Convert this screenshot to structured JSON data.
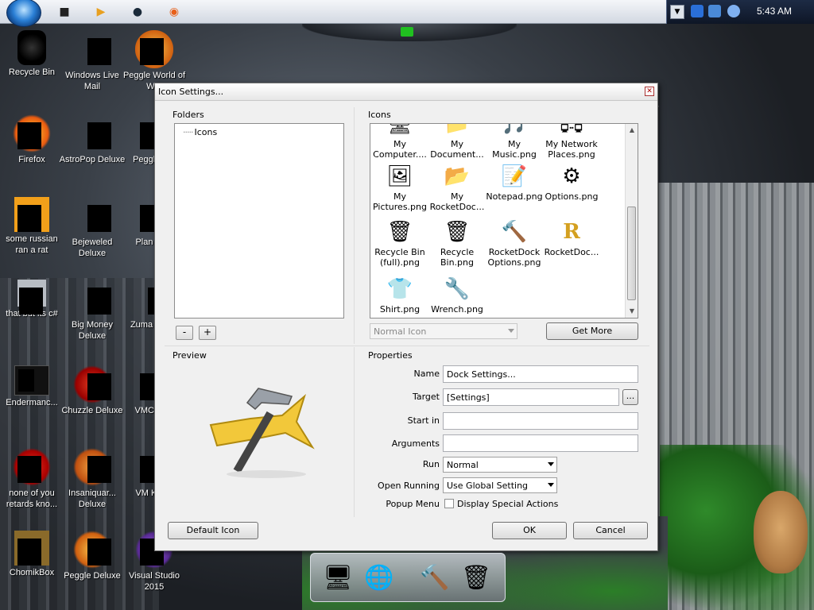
{
  "taskbar": {
    "start_icon": "windows-orb-icon",
    "pinned": [
      {
        "name": "black-cube-icon",
        "glyph": "■",
        "color": "#222222"
      },
      {
        "name": "media-player-icon",
        "glyph": "▶",
        "color": "#e8a020"
      },
      {
        "name": "black-circle-icon",
        "glyph": "●",
        "color": "#1a2a3a"
      },
      {
        "name": "firefox-icon",
        "glyph": "◉",
        "color": "#e8601a"
      }
    ],
    "clock": "5:43 AM"
  },
  "desktop_icons": [
    {
      "label": "Recycle Bin"
    },
    {
      "label": "Windows Live Mail"
    },
    {
      "label": "Peggle World of War"
    },
    {
      "label": "Firefox"
    },
    {
      "label": "AstroPop Deluxe"
    },
    {
      "label": "Peggle Del"
    },
    {
      "label": "some russian ran a rat"
    },
    {
      "label": "Bejeweled Deluxe"
    },
    {
      "label": "Plan Zom"
    },
    {
      "label": "that but its c#"
    },
    {
      "label": "Big Money Deluxe"
    },
    {
      "label": "Zuma"
    },
    {
      "label": "Endermanc..."
    },
    {
      "label": "Chuzzle Deluxe"
    },
    {
      "label": "VMC Kevi"
    },
    {
      "label": "none of you retards kno..."
    },
    {
      "label": "Insaniquar... Deluxe"
    },
    {
      "label": "VM Kevin"
    },
    {
      "label": "ChomikBox"
    },
    {
      "label": "Peggle Deluxe"
    },
    {
      "label": "Visual Studio 2015"
    }
  ],
  "dialog": {
    "title": "Icon Settings...",
    "folders": {
      "label": "Folders",
      "tree_item": "Icons",
      "remove_label": "-",
      "add_label": "+"
    },
    "icons": {
      "label": "Icons",
      "items": [
        {
          "label": "My Computer....",
          "icon": "computer-icon",
          "glyph": "🖥"
        },
        {
          "label": "My Document...",
          "icon": "documents-folder-icon",
          "glyph": "📁"
        },
        {
          "label": "My Music.png",
          "icon": "music-folder-icon",
          "glyph": "🎵"
        },
        {
          "label": "My Network Places.png",
          "icon": "network-icon",
          "glyph": "🖧"
        },
        {
          "label": "My Pictures.png",
          "icon": "pictures-folder-icon",
          "glyph": "🖼"
        },
        {
          "label": "My RocketDoc...",
          "icon": "rocketdock-folder-icon",
          "glyph": "📂"
        },
        {
          "label": "Notepad.png",
          "icon": "notepad-icon",
          "glyph": "📝"
        },
        {
          "label": "Options.png",
          "icon": "options-icon",
          "glyph": "⚙"
        },
        {
          "label": "Recycle Bin (full).png",
          "icon": "recycle-bin-full-icon",
          "glyph": "🗑"
        },
        {
          "label": "Recycle Bin.png",
          "icon": "recycle-bin-icon",
          "glyph": "🗑"
        },
        {
          "label": "RocketDock Options.png",
          "icon": "rocketdock-options-icon",
          "glyph": "🔨"
        },
        {
          "label": "RocketDoc...",
          "icon": "rocketdock-logo-icon",
          "glyph": "R"
        },
        {
          "label": "Shirt.png",
          "icon": "shirt-icon",
          "glyph": "👕"
        },
        {
          "label": "Wrench.png",
          "icon": "wrench-icon",
          "glyph": "🔧"
        }
      ],
      "size_select": "Normal Icon",
      "get_more": "Get More"
    },
    "preview": {
      "label": "Preview",
      "icon": "rocketdock-settings-hammer-icon"
    },
    "properties": {
      "label": "Properties",
      "name_label": "Name",
      "name_value": "Dock Settings...",
      "target_label": "Target",
      "target_value": "[Settings]",
      "browse_label": "...",
      "start_in_label": "Start in",
      "start_in_value": "",
      "arguments_label": "Arguments",
      "arguments_value": "",
      "run_label": "Run",
      "run_value": "Normal",
      "open_running_label": "Open Running",
      "open_running_value": "Use Global Setting",
      "popup_menu_label": "Popup Menu",
      "popup_menu_checkbox": "Display Special Actions"
    },
    "buttons": {
      "default_icon": "Default Icon",
      "ok": "OK",
      "cancel": "Cancel"
    }
  },
  "dock": {
    "items": [
      {
        "name": "monitor-icon",
        "glyph": "🖥"
      },
      {
        "name": "network-globe-icon",
        "glyph": "🌐"
      },
      {
        "name": "rocketdock-settings-icon",
        "glyph": "🔨"
      },
      {
        "name": "recycle-bin-icon",
        "glyph": "🗑"
      }
    ]
  }
}
